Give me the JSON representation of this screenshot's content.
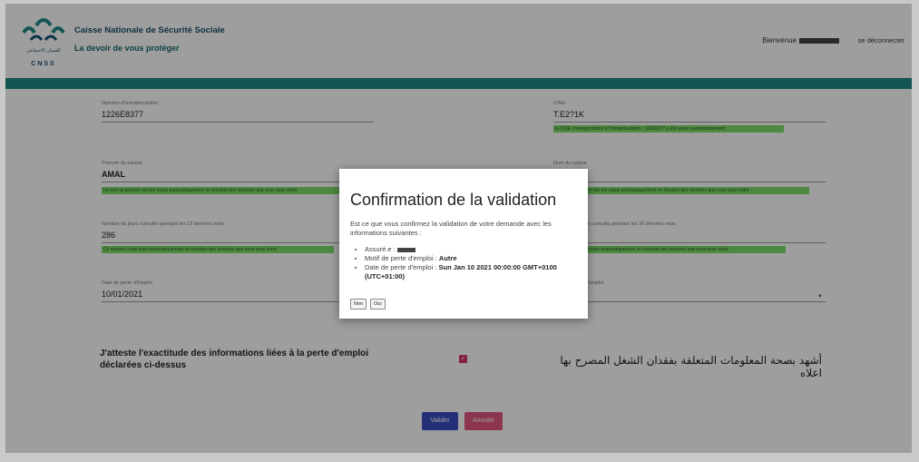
{
  "header": {
    "logo_text_ar": "الضمان الاجتماعي",
    "logo_text_latin": "CNSS",
    "org_name": "Caisse Nationale de Sécurité Sociale",
    "slogan": "La devoir de vous protéger",
    "welcome": "Bienvenue",
    "logout": "se déconnecter",
    "colors": {
      "accent": "#1e8a85",
      "title": "#1a4f6e"
    }
  },
  "form": {
    "immat": {
      "label": "Numéro d'immatriculation",
      "value": "1226E8377"
    },
    "cne": {
      "label": "CINE",
      "value": "T.E2?1K"
    },
    "cne_hint": "la CINE correspondante à l'immatriculation : 12268377 a été saisie automatiquement",
    "prenom": {
      "label": "Prénom du salarié",
      "value": "AMAL"
    },
    "prenom_hint": "Le nom et prénom ont été saisis automatiquement en fonction des données que vous avez entré",
    "nom": {
      "label": "Nom du salarié",
      "value": ""
    },
    "nom_hint": "Le nom et prénom ont été saisis automatiquement en fonction des données que vous avez entré",
    "jours12": {
      "label": "Nombre de jours cumulés pendant les 12 derniers mois",
      "value": "286"
    },
    "jours12_hint": "Ce nombre a été saisi automatiquement en fonction des données que vous avez entré",
    "jours36": {
      "label": "Nombre de jours cumulés pendant les 36 derniers mois",
      "value": ""
    },
    "jours36_hint": "Ce nombre a été saisi automatiquement en fonction des données que vous avez entré",
    "date_perte": {
      "label": "Date de perte d'Emploi",
      "value": "10/01/2021"
    },
    "motif": {
      "label": "Motif de perte d'emploi",
      "value": ""
    },
    "attest_fr": "J'atteste l'exactitude des informations liées à la perte d'emploi déclarées ci-dessus",
    "attest_ar": "أشهد بصحة المعلومات المتعلقة بفقدان الشغل المصرح بها اعلاه",
    "check_mark": "✓",
    "validate": "Valider",
    "cancel": "Annuler"
  },
  "modal": {
    "title": "Confirmation de la validation",
    "text": "Est ce que vous confirmez la validation de votre demande avec les informations suivantes :",
    "insured_label": "Assuré.e :",
    "motif_label": "Motif de perte d'emploi :",
    "motif_value": "Autre",
    "date_label": "Date de perte d'emploi :",
    "date_value": "Sun Jan 10 2021 00:00:00 GMT+0100 (UTC+01:00)",
    "no": "Non",
    "yes": "Oui"
  }
}
